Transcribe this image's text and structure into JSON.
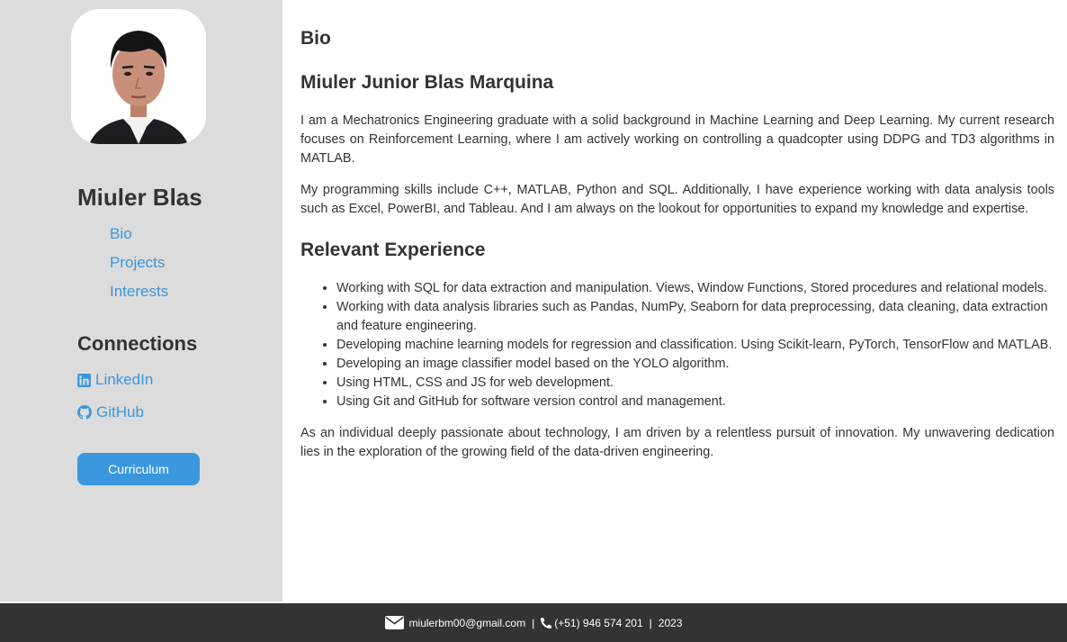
{
  "sidebar": {
    "name": "Miuler Blas",
    "nav": [
      {
        "label": "Bio"
      },
      {
        "label": "Projects"
      },
      {
        "label": "Interests"
      }
    ],
    "connections_title": "Connections",
    "connections": [
      {
        "label": "LinkedIn",
        "icon": "linkedin-icon"
      },
      {
        "label": "GitHub",
        "icon": "github-icon"
      }
    ],
    "cv_button": "Curriculum"
  },
  "main": {
    "bio_heading": "Bio",
    "full_name": "Miuler Junior Blas Marquina",
    "paragraphs": [
      "I am a Mechatronics Engineering graduate with a solid background in Machine Learning and Deep Learning. My current research focuses on Reinforcement Learning, where I am actively working on controlling a quadcopter using DDPG and TD3 algorithms in MATLAB.",
      "My programming skills include C++, MATLAB, Python and SQL. Additionally, I have experience working with data analysis tools such as Excel, PowerBI, and Tableau. And I am always on the lookout for opportunities to expand my knowledge and expertise."
    ],
    "experience_heading": "Relevant Experience",
    "experience": [
      "Working with SQL for data extraction and manipulation. Views, Window Functions, Stored procedures and relational models.",
      "Working with data analysis libraries such as Pandas, NumPy, Seaborn for data preprocessing, data cleaning, data extraction and feature engineering.",
      "Developing machine learning models for regression and classification. Using Scikit-learn, PyTorch, TensorFlow and MATLAB.",
      "Developing an image classifier model based on the YOLO algorithm.",
      "Using HTML, CSS and JS for web development.",
      "Using Git and GitHub for software version control and management."
    ],
    "closing": "As an individual deeply passionate about technology, I am driven by a relentless pursuit of innovation. My unwavering dedication lies in the exploration of the growing field of the data-driven engineering."
  },
  "footer": {
    "email": "miulerbm00@gmail.com",
    "phone": "(+51) 946 574 201",
    "year": "2023",
    "separator": "|"
  },
  "colors": {
    "accent": "#3a97dd",
    "sidebar_bg": "#dcdcdc",
    "footer_bg": "#333333"
  }
}
